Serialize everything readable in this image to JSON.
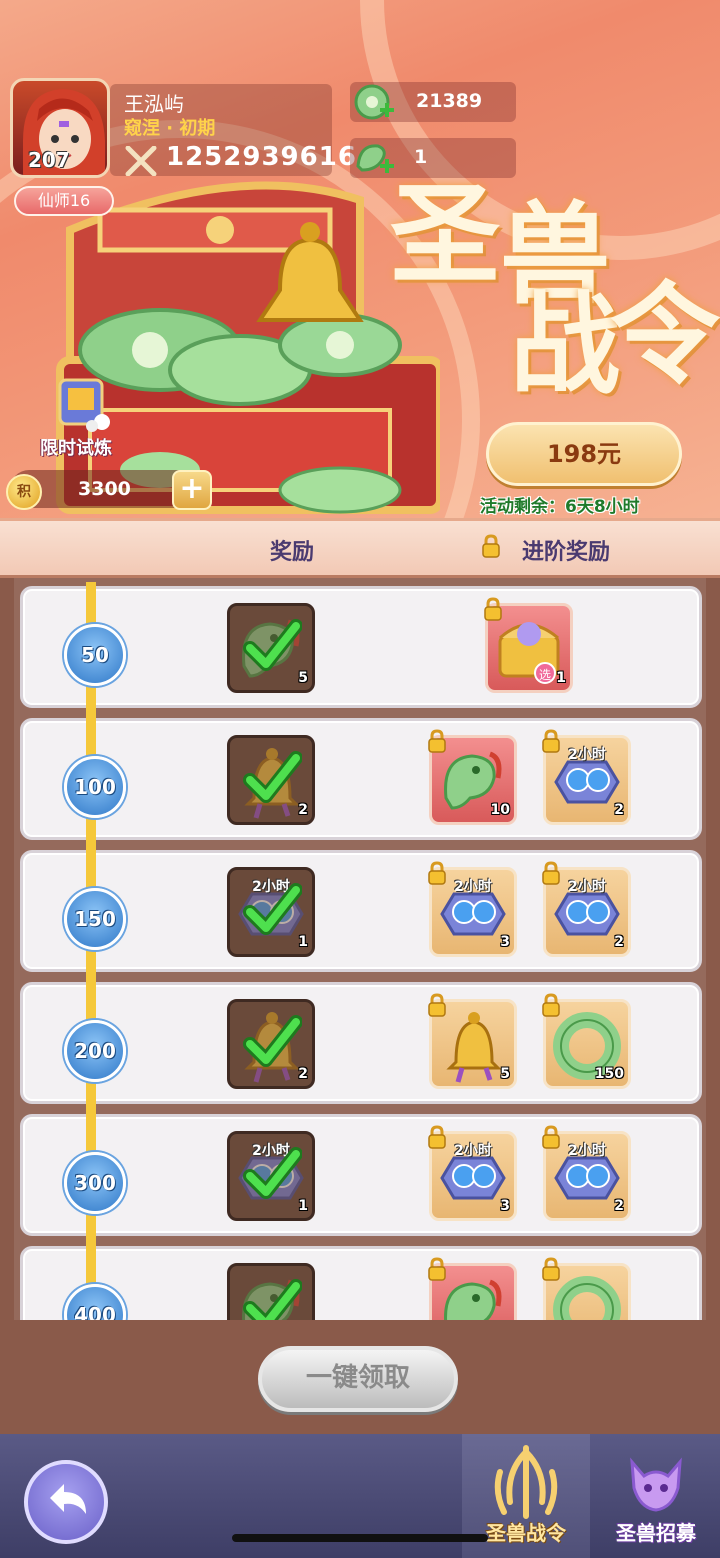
{
  "player": {
    "name": "王泓屿",
    "rank": "窥涅 · 初期",
    "level": "207",
    "power": "1252939616",
    "title": "仙师16"
  },
  "currencies": {
    "jade": "21389",
    "dragon_token": "1"
  },
  "banner": {
    "title_chars": [
      "圣",
      "兽",
      "战",
      "令"
    ]
  },
  "trial": {
    "label": "限时试炼"
  },
  "points": {
    "icon_text": "积",
    "value": "3300"
  },
  "purchase": {
    "price_label": "198元",
    "remaining_label": "活动剩余：6天8小时"
  },
  "columns": {
    "reward": "奖励",
    "advanced_reward": "进阶奖励"
  },
  "tiers": [
    {
      "level": "50",
      "free": {
        "icon": "jade-dragon-item",
        "count": "5",
        "claimed": true
      },
      "advanced": [
        {
          "icon": "selectable-chest",
          "count": "1",
          "style": "red",
          "tag": "",
          "badge": "选"
        }
      ]
    },
    {
      "level": "100",
      "free": {
        "icon": "bell-item",
        "count": "2",
        "claimed": true
      },
      "advanced": [
        {
          "icon": "jade-dragon-item",
          "count": "10",
          "style": "red",
          "tag": ""
        },
        {
          "icon": "blue-orb-chest",
          "count": "2",
          "style": "gold",
          "tag": "2小时"
        }
      ]
    },
    {
      "level": "150",
      "free": {
        "icon": "blue-orb-chest",
        "count": "1",
        "claimed": true,
        "tag": "2小时"
      },
      "advanced": [
        {
          "icon": "blue-orb-chest",
          "count": "3",
          "style": "gold",
          "tag": "2小时"
        },
        {
          "icon": "blue-orb-chest",
          "count": "2",
          "style": "gold",
          "tag": "2小时"
        }
      ]
    },
    {
      "level": "200",
      "free": {
        "icon": "bell-item",
        "count": "2",
        "claimed": true
      },
      "advanced": [
        {
          "icon": "bell-item",
          "count": "5",
          "style": "gold",
          "tag": ""
        },
        {
          "icon": "jade-ring-item",
          "count": "150",
          "style": "gold",
          "tag": ""
        }
      ]
    },
    {
      "level": "300",
      "free": {
        "icon": "blue-orb-chest",
        "count": "1",
        "claimed": true,
        "tag": "2小时"
      },
      "advanced": [
        {
          "icon": "blue-orb-chest",
          "count": "3",
          "style": "gold",
          "tag": "2小时"
        },
        {
          "icon": "blue-orb-chest",
          "count": "2",
          "style": "gold",
          "tag": "2小时"
        }
      ]
    },
    {
      "level": "400",
      "free": {
        "icon": "jade-dragon-item",
        "count": "",
        "claimed": true
      },
      "advanced": [
        {
          "icon": "jade-dragon-item",
          "count": "",
          "style": "red",
          "tag": ""
        },
        {
          "icon": "jade-ring-item",
          "count": "",
          "style": "gold",
          "tag": ""
        }
      ]
    }
  ],
  "collect_all": "一键领取",
  "tabs": [
    {
      "label": "圣兽战令",
      "active": true
    },
    {
      "label": "圣兽招募",
      "active": false
    }
  ],
  "colors": {
    "accent": "#f08a6c",
    "track": "#f5c83a",
    "level_badge": "#2f78c8",
    "remaining_text": "#1f7a2a"
  }
}
